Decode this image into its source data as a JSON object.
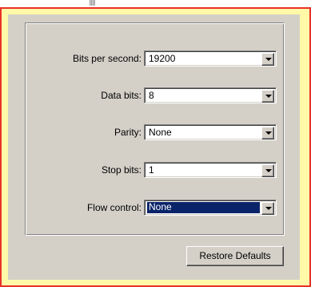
{
  "fields": [
    {
      "label": "Bits per second:",
      "value": "19200"
    },
    {
      "label": "Data bits:",
      "value": "8"
    },
    {
      "label": "Parity:",
      "value": "None"
    },
    {
      "label": "Stop bits:",
      "value": "1"
    },
    {
      "label": "Flow control:",
      "value": "None"
    }
  ],
  "restore_label": "Restore Defaults",
  "colors": {
    "frame_border": "#e8322a",
    "frame_fill": "#fff9a8",
    "dialog_face": "#d4d0c8",
    "selection": "#0a246a"
  },
  "icons": {
    "dropdown": "chevron-down-icon"
  }
}
